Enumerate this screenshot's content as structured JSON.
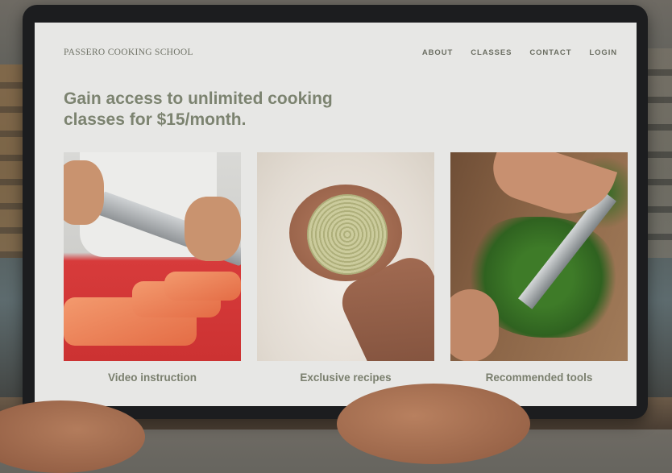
{
  "brand": "PASSERO COOKING SCHOOL",
  "nav": {
    "items": [
      "ABOUT",
      "CLASSES",
      "CONTACT",
      "LOGIN"
    ]
  },
  "hero": {
    "headline": "Gain access to unlimited cooking classes for $15/month."
  },
  "features": [
    {
      "caption": "Video instruction",
      "image": "salmon-filleting-photo"
    },
    {
      "caption": "Exclusive recipes",
      "image": "fresh-noodles-photo"
    },
    {
      "caption": "Recommended tools",
      "image": "chopping-herbs-photo"
    }
  ],
  "colors": {
    "accent": "#7c8370",
    "screen_bg": "#e7e7e5",
    "nav_text": "#6b6e62"
  }
}
